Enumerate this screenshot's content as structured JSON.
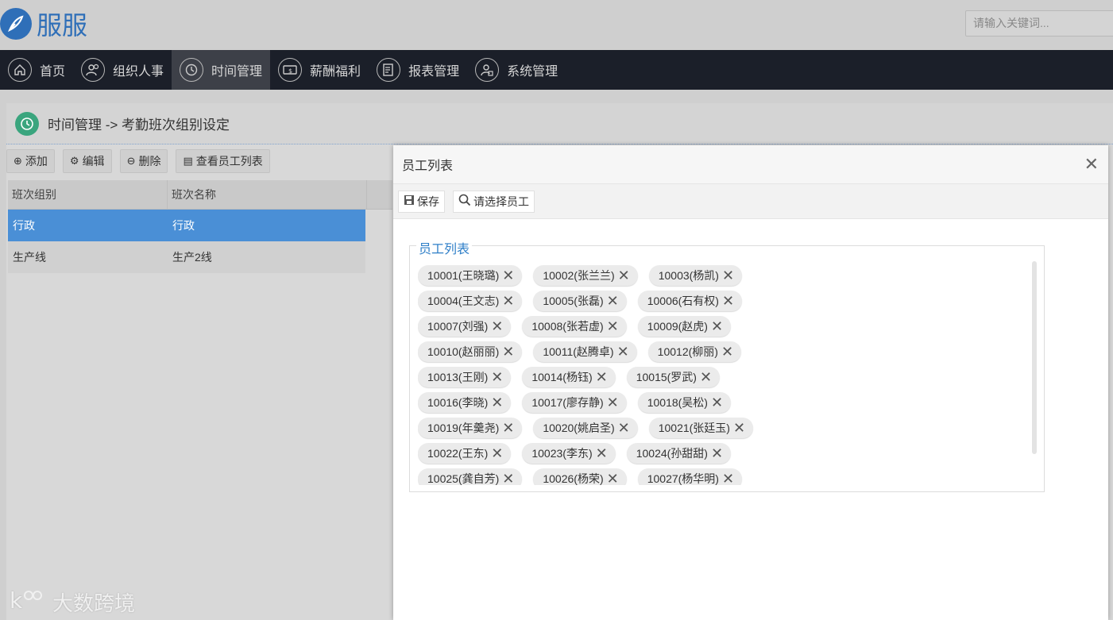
{
  "app": {
    "logo_text": "服服"
  },
  "search": {
    "placeholder": "请输入关键词..."
  },
  "nav": [
    {
      "label": "首页",
      "icon": "home-icon"
    },
    {
      "label": "组织人事",
      "icon": "users-icon"
    },
    {
      "label": "时间管理",
      "icon": "clock-icon",
      "active": true
    },
    {
      "label": "薪酬福利",
      "icon": "money-icon"
    },
    {
      "label": "报表管理",
      "icon": "report-icon"
    },
    {
      "label": "系统管理",
      "icon": "system-user-icon"
    }
  ],
  "breadcrumb": {
    "text": "时间管理 -> 考勤班次组别设定"
  },
  "toolbar": {
    "add": "添加",
    "edit": "编辑",
    "delete": "删除",
    "view_employees": "查看员工列表"
  },
  "grid": {
    "columns": [
      "班次组别",
      "班次名称"
    ],
    "rows": [
      {
        "group": "行政",
        "name": "行政",
        "selected": true
      },
      {
        "group": "生产线",
        "name": "生产2线",
        "selected": false
      }
    ]
  },
  "dialog": {
    "title": "员工列表",
    "save": "保存",
    "select_employee": "请选择员工",
    "fieldset_legend": "员工列表",
    "employees": [
      [
        "10001(王晓璐)",
        "10002(张兰兰)",
        "10003(杨凯)"
      ],
      [
        "10004(王文志)",
        "10005(张磊)",
        "10006(石有权)"
      ],
      [
        "10007(刘强)",
        "10008(张若虚)",
        "10009(赵虎)"
      ],
      [
        "10010(赵丽丽)",
        "10011(赵腾卓)",
        "10012(柳丽)"
      ],
      [
        "10013(王刚)",
        "10014(杨钰)",
        "10015(罗武)"
      ],
      [
        "10016(李晓)",
        "10017(廖存静)",
        "10018(吴松)"
      ],
      [
        "10019(年羹尧)",
        "10020(姚启圣)",
        "10021(张廷玉)"
      ],
      [
        "10022(王东)",
        "10023(李东)",
        "10024(孙甜甜)"
      ],
      [
        "10025(龚自芳)",
        "10026(杨荣)",
        "10027(杨华明)"
      ]
    ]
  },
  "watermark": {
    "text": "大数跨境"
  },
  "colors": {
    "nav_bg": "#1b1f29",
    "accent_blue": "#2f6fb8",
    "selected_row": "#4a8fd6",
    "crumb_icon": "#3aa57e"
  }
}
